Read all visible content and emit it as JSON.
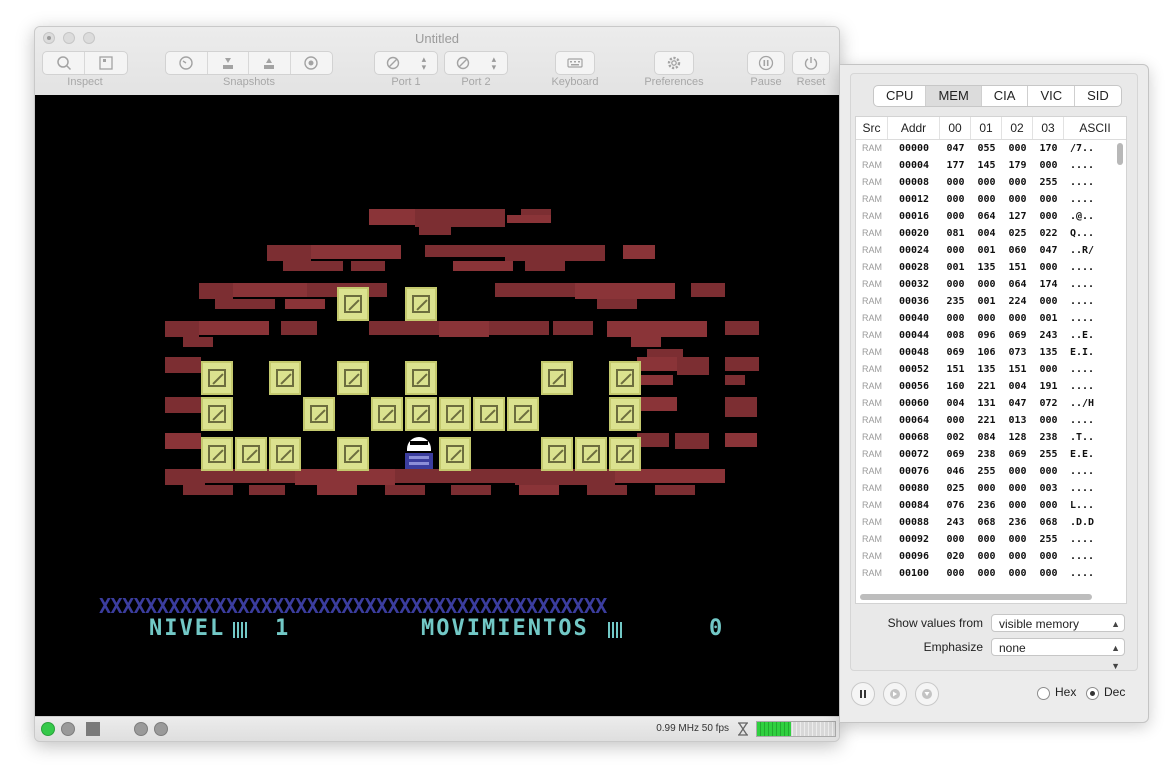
{
  "window": {
    "title": "Untitled"
  },
  "toolbar": {
    "inspect": "Inspect",
    "snapshots": "Snapshots",
    "port1": "Port 1",
    "port2": "Port 2",
    "keyboard": "Keyboard",
    "preferences": "Preferences",
    "pause": "Pause",
    "reset": "Reset"
  },
  "game": {
    "xrow": "XXXXXXXXXXXXXXXXXXXXXXXXXXXXXXXXXXXXXXXXXXXX",
    "level_label": "NIVEL",
    "level_value": "1",
    "moves_label": "MOVIMIENTOS",
    "moves_value": "0",
    "colors": {
      "brick": "#7c2e32",
      "crate": "#dbe28f",
      "player": "#3b3d9e",
      "hud": "#72c8c6"
    }
  },
  "status": {
    "speed": "0.99 MHz 50 fps"
  },
  "inspector": {
    "tabs": [
      "CPU",
      "MEM",
      "CIA",
      "VIC",
      "SID"
    ],
    "active_tab": "MEM",
    "columns": [
      "Src",
      "Addr",
      "00",
      "01",
      "02",
      "03",
      "ASCII"
    ],
    "rows": [
      [
        "RAM",
        "00000",
        "047",
        "055",
        "000",
        "170",
        "/7.."
      ],
      [
        "RAM",
        "00004",
        "177",
        "145",
        "179",
        "000",
        "...."
      ],
      [
        "RAM",
        "00008",
        "000",
        "000",
        "000",
        "255",
        "...."
      ],
      [
        "RAM",
        "00012",
        "000",
        "000",
        "000",
        "000",
        "...."
      ],
      [
        "RAM",
        "00016",
        "000",
        "064",
        "127",
        "000",
        ".@.."
      ],
      [
        "RAM",
        "00020",
        "081",
        "004",
        "025",
        "022",
        "Q..."
      ],
      [
        "RAM",
        "00024",
        "000",
        "001",
        "060",
        "047",
        "..R/"
      ],
      [
        "RAM",
        "00028",
        "001",
        "135",
        "151",
        "000",
        "...."
      ],
      [
        "RAM",
        "00032",
        "000",
        "000",
        "064",
        "174",
        "...."
      ],
      [
        "RAM",
        "00036",
        "235",
        "001",
        "224",
        "000",
        "...."
      ],
      [
        "RAM",
        "00040",
        "000",
        "000",
        "000",
        "001",
        "...."
      ],
      [
        "RAM",
        "00044",
        "008",
        "096",
        "069",
        "243",
        "..E."
      ],
      [
        "RAM",
        "00048",
        "069",
        "106",
        "073",
        "135",
        "E.I."
      ],
      [
        "RAM",
        "00052",
        "151",
        "135",
        "151",
        "000",
        "...."
      ],
      [
        "RAM",
        "00056",
        "160",
        "221",
        "004",
        "191",
        "...."
      ],
      [
        "RAM",
        "00060",
        "004",
        "131",
        "047",
        "072",
        "../H"
      ],
      [
        "RAM",
        "00064",
        "000",
        "221",
        "013",
        "000",
        "...."
      ],
      [
        "RAM",
        "00068",
        "002",
        "084",
        "128",
        "238",
        ".T.."
      ],
      [
        "RAM",
        "00072",
        "069",
        "238",
        "069",
        "255",
        "E.E."
      ],
      [
        "RAM",
        "00076",
        "046",
        "255",
        "000",
        "000",
        "...."
      ],
      [
        "RAM",
        "00080",
        "025",
        "000",
        "000",
        "003",
        "...."
      ],
      [
        "RAM",
        "00084",
        "076",
        "236",
        "000",
        "000",
        "L..."
      ],
      [
        "RAM",
        "00088",
        "243",
        "068",
        "236",
        "068",
        ".D.D"
      ],
      [
        "RAM",
        "00092",
        "000",
        "000",
        "000",
        "255",
        "...."
      ],
      [
        "RAM",
        "00096",
        "020",
        "000",
        "000",
        "000",
        "...."
      ],
      [
        "RAM",
        "00100",
        "000",
        "000",
        "000",
        "000",
        "...."
      ]
    ],
    "show_values_label": "Show values from",
    "show_values_value": "visible memory",
    "emphasize_label": "Emphasize",
    "emphasize_value": "none",
    "format_hex": "Hex",
    "format_dec": "Dec",
    "format_selected": "Dec"
  }
}
